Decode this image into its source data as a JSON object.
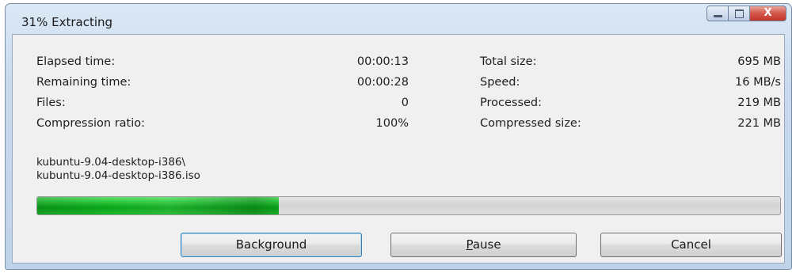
{
  "window": {
    "title": "31% Extracting",
    "controls": {
      "minimize": "minimize-icon",
      "maximize": "maximize-icon",
      "close": "close-icon",
      "close_glyph": "X"
    }
  },
  "stats_left": [
    {
      "label": "Elapsed time:",
      "value": "00:00:13"
    },
    {
      "label": "Remaining time:",
      "value": "00:00:28"
    },
    {
      "label": "Files:",
      "value": "0"
    },
    {
      "label": "Compression ratio:",
      "value": "100%"
    }
  ],
  "stats_right": [
    {
      "label": "Total size:",
      "value": "695 MB"
    },
    {
      "label": "Speed:",
      "value": "16 MB/s"
    },
    {
      "label": "Processed:",
      "value": "219 MB"
    },
    {
      "label": "Compressed size:",
      "value": "221 MB"
    }
  ],
  "current_path": {
    "folder": "kubuntu-9.04-desktop-i386\\",
    "file": "kubuntu-9.04-desktop-i386.iso"
  },
  "progress": {
    "fraction": 0.325,
    "color": "#1cb82a"
  },
  "buttons": {
    "background": {
      "label": "Background"
    },
    "pause": {
      "mnemonic": "P",
      "rest": "ause"
    },
    "cancel": {
      "label": "Cancel"
    }
  }
}
